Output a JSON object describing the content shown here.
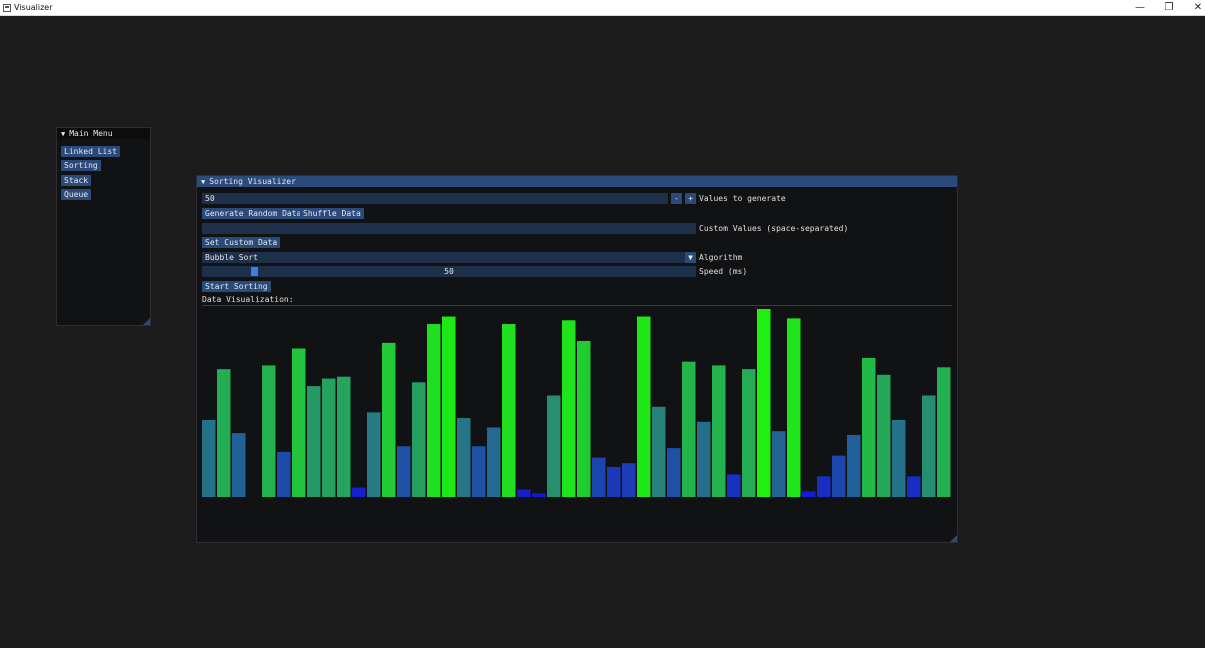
{
  "window": {
    "title": "Visualizer",
    "controls": {
      "minimize": "—",
      "restore": "❐",
      "close": "✕"
    }
  },
  "main_menu": {
    "title": "Main Menu",
    "items": [
      {
        "label": "Linked List"
      },
      {
        "label": "Sorting"
      },
      {
        "label": "Stack"
      },
      {
        "label": "Queue"
      }
    ]
  },
  "sorting": {
    "title": "Sorting Visualizer",
    "count_value": "50",
    "count_label": "Values to generate",
    "minus": "-",
    "plus": "+",
    "generate_label": "Generate Random Data",
    "shuffle_label": "Shuffle Data",
    "custom_value": "",
    "custom_label": "Custom Values (space-separated)",
    "set_custom_label": "Set Custom Data",
    "algorithm_value": "Bubble Sort",
    "algorithm_label": "Algorithm",
    "dropdown_arrow": "▼",
    "speed_value": "50",
    "speed_label": "Speed (ms)",
    "speed_min": 0,
    "speed_max": 500,
    "start_label": "Start Sorting",
    "viz_label": "Data Visualization:"
  },
  "bars": {
    "values": [
      41,
      68,
      34,
      0,
      70,
      24,
      79,
      59,
      63,
      64,
      5,
      45,
      82,
      27,
      61,
      92,
      96,
      42,
      27,
      37,
      92,
      4,
      2,
      54,
      94,
      83,
      21,
      16,
      18,
      96,
      48,
      26,
      72,
      40,
      70,
      12,
      68,
      100,
      35,
      95,
      3,
      11,
      22,
      33,
      74,
      65,
      41,
      11,
      54,
      69
    ],
    "max": 100
  }
}
